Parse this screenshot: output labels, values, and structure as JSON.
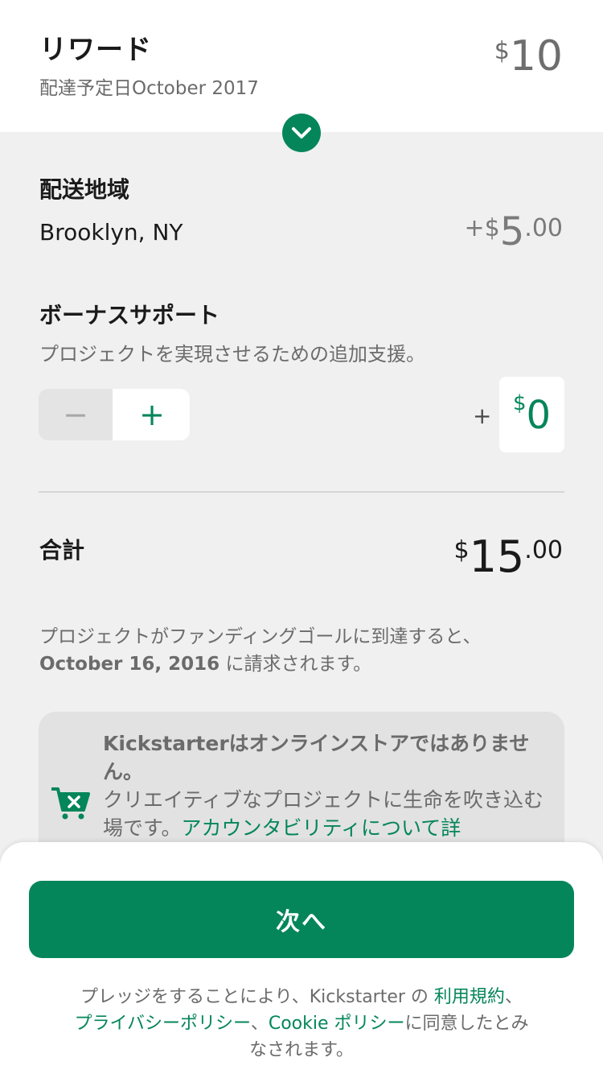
{
  "reward": {
    "title": "リワード",
    "delivery": "配達予定日October 2017",
    "currency": "$",
    "amount": "10"
  },
  "shipping": {
    "title": "配送地域",
    "location": "Brooklyn, NY",
    "sign": "+$",
    "dollars": "5",
    "cents": ".00"
  },
  "bonus": {
    "title": "ボーナスサポート",
    "subtitle": "プロジェクトを実現させるための追加支援。",
    "minus_label": "−",
    "plus_label": "+",
    "prefix": "+",
    "currency": "$",
    "amount": "0"
  },
  "total": {
    "label": "合計",
    "currency": "$",
    "amount": "15",
    "cents": ".00"
  },
  "charge_note": {
    "line1": "プロジェクトがファンディングゴールに到達すると、",
    "date": "October 16, 2016",
    "line2_rest": " に請求されます。"
  },
  "info_card": {
    "heading": "Kickstarterはオンラインストアではありません。",
    "body": "クリエイティブなプロジェクトに生命を吹き込む場です。",
    "link": "アカウンタビリティについて詳"
  },
  "footer": {
    "next_label": "次へ",
    "legal_prefix": "プレッジをすることにより、Kickstarter の ",
    "terms_link": "利用規約",
    "sep1": "、",
    "privacy_link": "プライバシーポリシー",
    "sep2": "、",
    "cookie_link": "Cookie ポリシー",
    "legal_suffix": "に同意したとみなされます。"
  },
  "colors": {
    "accent": "#05865a",
    "background": "#f0f0f0",
    "muted_text": "#6b6b6b"
  },
  "icons": [
    "chevron-down-icon",
    "cart-x-icon"
  ]
}
